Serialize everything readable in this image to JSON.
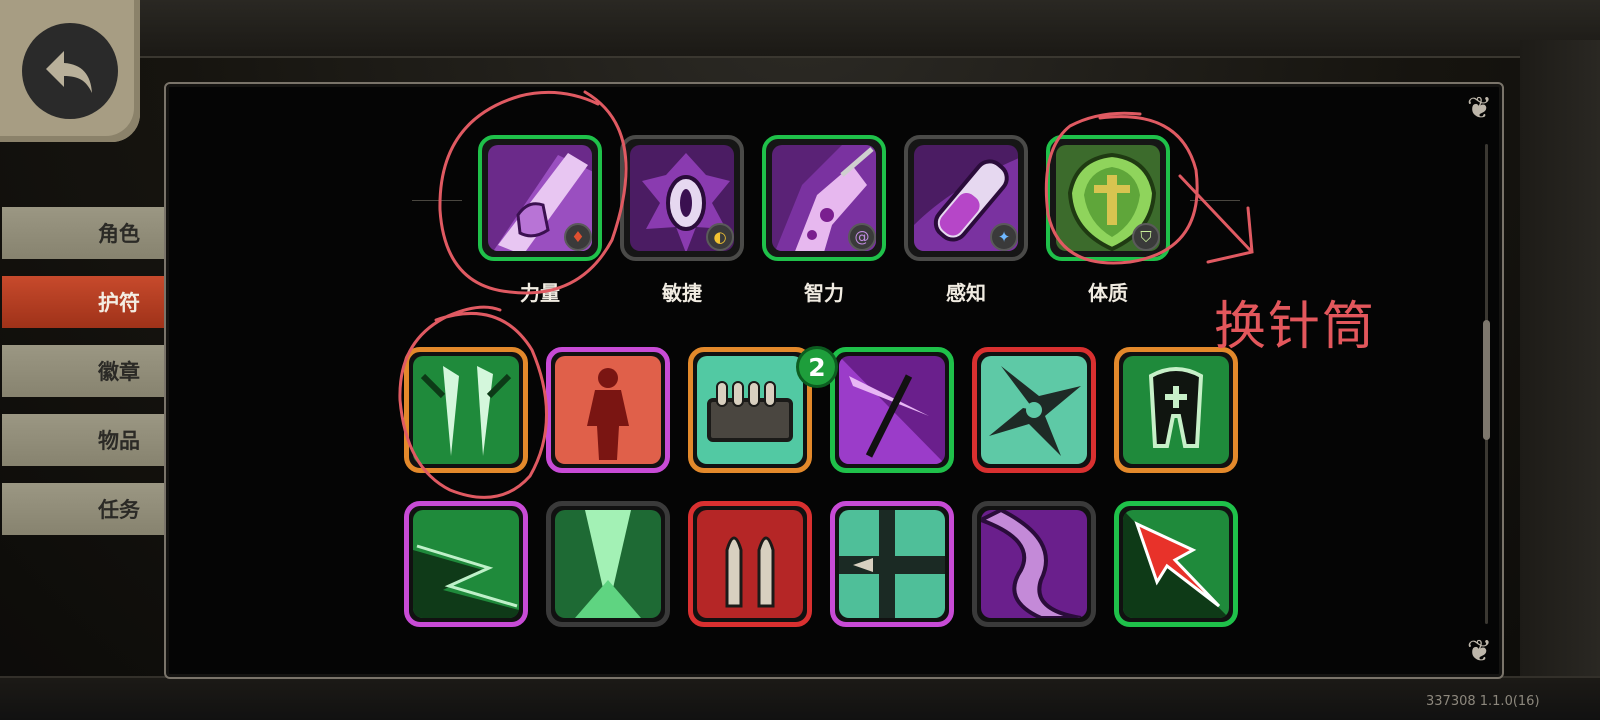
{
  "sidebar": {
    "items": [
      {
        "label": "角色",
        "active": false
      },
      {
        "label": "护符",
        "active": true
      },
      {
        "label": "徽章",
        "active": false
      },
      {
        "label": "物品",
        "active": false
      },
      {
        "label": "任务",
        "active": false
      }
    ]
  },
  "attributes": [
    {
      "label": "力量",
      "icon": "fist-icon",
      "badge_icon": "flame-badge-icon",
      "selected": true
    },
    {
      "label": "敏捷",
      "icon": "spiked-eye-icon",
      "badge_icon": "pacman-badge-icon",
      "selected": false
    },
    {
      "label": "智力",
      "icon": "syringe-arm-icon",
      "badge_icon": "spiral-badge-icon",
      "selected": true
    },
    {
      "label": "感知",
      "icon": "vial-icon",
      "badge_icon": "sparkle-badge-icon",
      "selected": false
    },
    {
      "label": "体质",
      "icon": "armor-icon",
      "badge_icon": "shield-badge-icon",
      "selected": true
    }
  ],
  "amulets": [
    {
      "icon": "claws-icon",
      "rarity_color": "#e3892b"
    },
    {
      "icon": "red-figure-icon",
      "rarity_color": "#c84bd6"
    },
    {
      "icon": "bullet-belt-icon",
      "rarity_color": "#e3892b",
      "count": "2"
    },
    {
      "icon": "arrow-burst-icon",
      "rarity_color": "#1fc14a"
    },
    {
      "icon": "shuriken-icon",
      "rarity_color": "#d93030"
    },
    {
      "icon": "tooth-cross-icon",
      "rarity_color": "#e3892b"
    },
    {
      "icon": "lightning-icon",
      "rarity_color": "#c84bd6"
    },
    {
      "icon": "green-splash-icon",
      "rarity_color": "#3a3a3a"
    },
    {
      "icon": "twin-bullets-icon",
      "rarity_color": "#d93030"
    },
    {
      "icon": "pipe-bullet-icon",
      "rarity_color": "#c84bd6"
    },
    {
      "icon": "tentacle-icon",
      "rarity_color": "#3a3a3a"
    },
    {
      "icon": "red-arrow-icon",
      "rarity_color": "#1fc14a"
    }
  ],
  "annotation": {
    "text": "换针筒",
    "color": "#e3575c"
  },
  "version": "337308 1.1.0(16)",
  "icons": {
    "back": "back-arrow-icon",
    "corner": "ornament-icon"
  }
}
